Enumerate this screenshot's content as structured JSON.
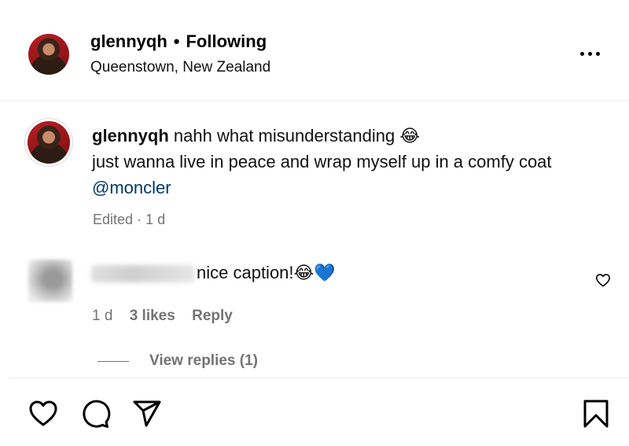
{
  "post_header": {
    "username": "glennyqh",
    "separator": "•",
    "follow_state": "Following",
    "location": "Queenstown, New Zealand"
  },
  "caption": {
    "author": "glennyqh",
    "line1": "nahh what misunderstanding 😂",
    "line2": "just wanna live in peace and wrap myself up in a comfy coat",
    "mention": "@moncler",
    "edited": "Edited",
    "dot": "·",
    "age": "1 d"
  },
  "comment": {
    "text": "nice caption!😂💙",
    "age": "1 d",
    "likes": "3 likes",
    "reply_label": "Reply",
    "view_replies": "View replies (1)"
  },
  "icons": {
    "more": "more-horizontal-icon",
    "like": "heart-icon",
    "comment": "comment-bubble-icon",
    "share": "paper-plane-icon",
    "save": "bookmark-icon"
  },
  "colors": {
    "text": "#000000",
    "secondary": "#737373",
    "mention": "#00376b",
    "divider": "#efefef"
  }
}
